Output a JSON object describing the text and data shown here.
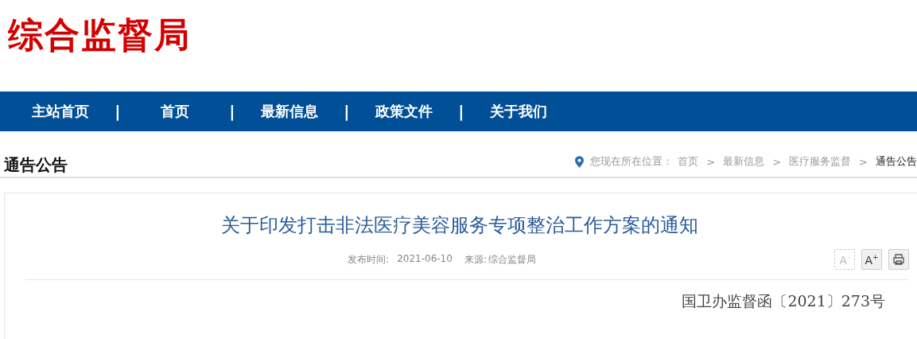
{
  "site": {
    "logo": "综合监督局"
  },
  "nav": {
    "items": [
      {
        "kind": "link",
        "label": "主站首页"
      },
      {
        "kind": "sep",
        "label": "|"
      },
      {
        "kind": "link",
        "label": "首页"
      },
      {
        "kind": "sep",
        "label": "|"
      },
      {
        "kind": "link",
        "label": "最新信息"
      },
      {
        "kind": "sep",
        "label": "|"
      },
      {
        "kind": "link",
        "label": "政策文件"
      },
      {
        "kind": "sep",
        "label": "|"
      },
      {
        "kind": "link",
        "label": "关于我们"
      }
    ]
  },
  "section": {
    "title": "通告公告"
  },
  "breadcrumb": {
    "prefix": "您现在所在位置：",
    "items": [
      {
        "kind": "link",
        "label": "首页"
      },
      {
        "kind": "sep",
        "label": ">"
      },
      {
        "kind": "link",
        "label": "最新信息"
      },
      {
        "kind": "sep",
        "label": ">"
      },
      {
        "kind": "link",
        "label": "医疗服务监督"
      },
      {
        "kind": "sep",
        "label": ">"
      },
      {
        "kind": "current",
        "label": "通告公告"
      }
    ]
  },
  "article": {
    "title": "关于印发打击非法医疗美容服务专项整治工作方案的通知",
    "meta": [
      {
        "label": "发布时间:",
        "value": "2021-06-10"
      },
      {
        "label": "来源:",
        "value": "综合监督局"
      }
    ],
    "tools": [
      {
        "kind": "smaller",
        "label": "A$^{-}$",
        "disabled": true
      },
      {
        "kind": "larger",
        "label": "A$^{+}$",
        "disabled": false
      },
      {
        "kind": "print",
        "disabled": false
      }
    ],
    "doc_number": "国卫办监督函〔2021〕273号"
  }
}
